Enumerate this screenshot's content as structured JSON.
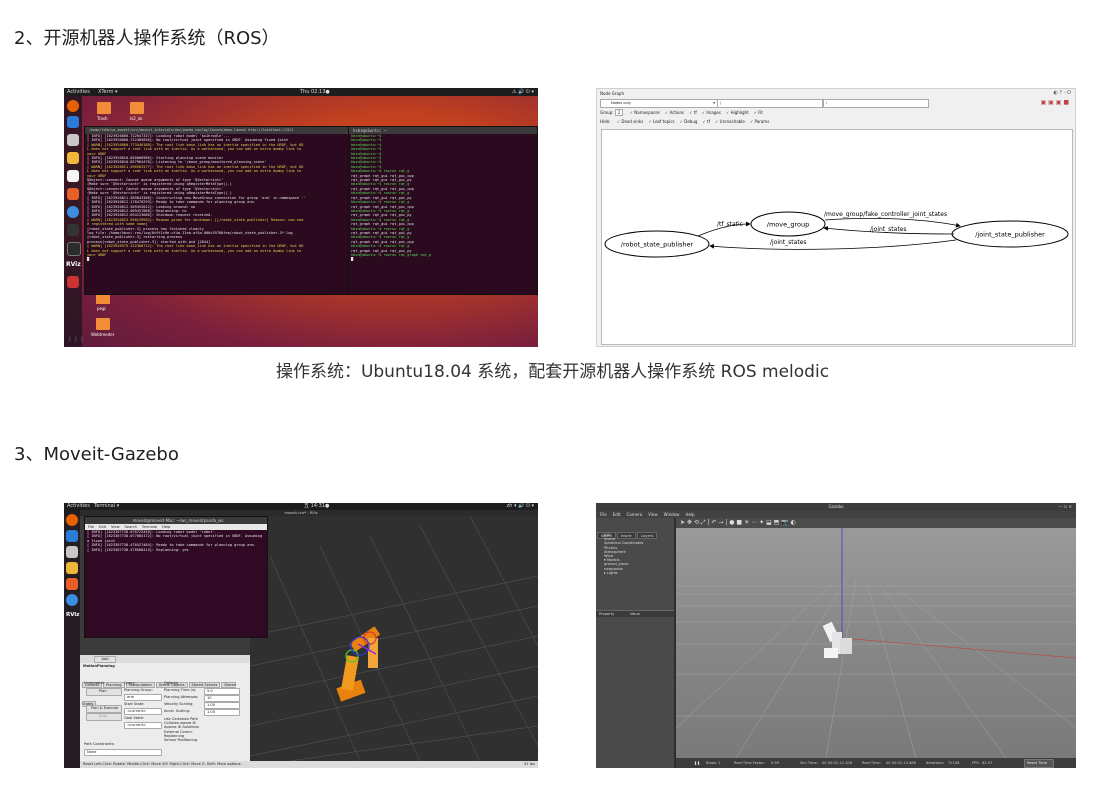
{
  "section2": {
    "title": "2、开源机器人操作系统（ROS）"
  },
  "caption2": "操作系统：Ubuntu18.04 系统，配套开源机器人操作系统 ROS melodic",
  "section3": {
    "title": "3、Moveit-Gazebo"
  },
  "ubuntu_desktop": {
    "topbar_left": "Activities",
    "topbar_app": "XTerm ▾",
    "topbar_clock": "Thu 02:13●",
    "desktop_icons": [
      "Trash",
      "ls2_ok",
      "pegi",
      "Webtreeder"
    ],
    "dock_label_rviz": "RViz",
    "left_terminal_title": "/home/lshb/ws_moveit/src/moveit_tutorials/doc/panda_config/launch/demo.launch http://localhost:11311",
    "right_terminal_title": "hsbz@ubuntu: ~",
    "left_terminal_lines": [
      "[ INFO] [1623926860.722047337]: Loading robot model 'ko1hrodle'...",
      "[ INFO] [1623926860.722485850]: No root/virtual joint specified in SRDF. Assuming fixed joint",
      "[ WARN] [1623926860.773440188]: The root link base_link has an inertia specified in the URDF, but KD",
      "L does not support a root link with an inertia. As a workaround, you can add an extra dummy link to",
      "your URDF",
      "[ INFO] [1623926810.850066986]: Starting planning scene monitor",
      "[ INFO] [1623926810.857964476]: Listening to '/move_group/monitored_planning_scene'",
      "[ WARN] [1623926811.490562577]: The root link base_link has an inertia specified in the URDF, but KD",
      "L does not support a root link with an inertia. As a workaround, you can add an extra dummy link to",
      "your URDF",
      "QObject::connect: Cannot queue arguments of type 'QVector<int>'",
      "(Make sure 'QVector<int>' is registered using qRegisterMetaType().)",
      "QObject::connect: Cannot queue arguments of type 'QVector<int>'",
      "(Make sure 'QVector<int>' is registered using qRegisterMetaType().)",
      "[ INFO] [1623926811.589843306]: Constructing new MoveGroup connection for group 'arm' in namespace ''",
      "",
      "[ INFO] [1623926812.178476293]: Ready to take commands for planning group arm.",
      "[ INFO] [1623926812.509453012]: Looking around: no",
      "[ INFO] [1623926812.509457866]: Replanning: no",
      "[ INFO] [1623926812.654123686]: Shutdown request received.",
      "[ WARN] [1623926823.958129932]: Reason given for shutdown: [[/robot_state_publisher] Reason: new nod",
      "e registered with same name]",
      "[robot_state_publisher-3] process has finished cleanly",
      "log file: /home/hbzn/.ros/log/8c9f1c9e-cf4a-11eb-af5a-000c29700fea/robot_state_publisher-3*.log",
      "[robot_state_publisher-3] restarting process",
      "process[robot_state_publisher-3]: started with pid [2844]",
      "[ WARN] [1623926975.122368712]: The root link base_link has an inertia specified in the URDF, but KD",
      "L does not support a root link with an inertia. As a workaround, you can add an extra dummy link to",
      "your URDF",
      "█"
    ],
    "right_terminal_lines": [
      "hbzn@ubuntu:~$",
      "hbzn@ubuntu:~$",
      "hbzn@ubuntu:~$",
      "hbzn@ubuntu:~$",
      "hbzn@ubuntu:~$",
      "hbzn@ubuntu:~$",
      "hbzn@ubuntu:~$",
      "hbzn@ubuntu:~$",
      "hbzn@ubuntu:~$ rosrun rqt_g",
      "rqt_graph    rqt_gui    rqt_gui_cpp",
      "rqt_graph    rqt_gui    rqt_gui_py",
      "hbzn@ubuntu:~$ rosrun rqt_g",
      "rqt_graph    rqt_gui    rqt_gui_cpp",
      "hbzn@ubuntu:~$ rosrun rqt_g",
      "rqt_graph    rqt_gui    rqt_gui_py",
      "hbzn@ubuntu:~$ rosrun rqt_g",
      "rqt_graph    rqt_gui    rqt_gui_cpp",
      "hbzn@ubuntu:~$ rosrun rqt_g",
      "rqt_graph    rqt_gui    rqt_gui_py",
      "hbzn@ubuntu:~$ rosrun rqt_g",
      "rqt_graph    rqt_gui    rqt_gui_cpp",
      "hbzn@ubuntu:~$ rosrun rqt_g",
      "rqt_graph    rqt_gui    rqt_gui_py",
      "hbzn@ubuntu:~$ rosrun rqt_g",
      "rqt_graph    rqt_gui    rqt_gui_cpp",
      "hbzn@ubuntu:~$ rosrun rqt_g",
      "rqt_graph    rqt_gui    rqt_gui_py",
      "hbzn@ubuntu:~$ rosrun rqt_graph rqt_g",
      "█"
    ]
  },
  "node_graph": {
    "window_title": "Node Graph",
    "filter_select": "Nodes only",
    "filter_text1": "/",
    "filter_text2": "/",
    "group_label": "Group:",
    "group_value": "2",
    "checks_row1": [
      "Namespaces",
      "Actions",
      "tf",
      "Images",
      "Highlight",
      "Fit"
    ],
    "hide_label": "Hide:",
    "checks_row2": [
      "Dead sinks",
      "Leaf topics",
      "Debug",
      "tf",
      "Unreachable",
      "Params"
    ],
    "nodes": {
      "move_group": "/move_group",
      "joint_state_publisher": "/joint_state_publisher",
      "robot_state_publisher": "/robot_state_publisher"
    },
    "edges": {
      "tf_static": "/tf_static",
      "fake_controller": "/move_group/fake_controller_joint_states",
      "joint_states_1": "/joint_states",
      "joint_states_2": "/joint_states"
    }
  },
  "moveit": {
    "topbar_left": "Activities",
    "topbar_app": "Terminal ▾",
    "topbar_clock": "五 14:31●",
    "terminal_title": "moveit@moveit-Mac: ~/ws_moveit/panda_ws",
    "terminal_menu": [
      "File",
      "Edit",
      "View",
      "Search",
      "Terminal",
      "Help"
    ],
    "terminal_lines": [
      "[ INFO] [1623307738.076723450]: Loading robot model 'robot'...",
      "[ INFO] [1623307738.077085172]: No root/virtual joint specified in SRDF. Assuming",
      "a fixed joint",
      "[ INFO] [1623307738.478427464]: Ready to take commands for planning group arm.",
      "[ INFO] [1623307738.478568415]: Replanning: yes"
    ],
    "rviz_title": "moveit.rviz* - RViz",
    "dock_label": "RViz",
    "panel_title": "MotionPlanning",
    "tabs": [
      "Context",
      "Planning",
      "Manipulation",
      "Scene Objects",
      "Stored Scenes",
      "Stored States"
    ],
    "col_commands": "Commands",
    "col_query": "Query",
    "col_options": "Options",
    "btn_plan": "Plan",
    "btn_plan_execute": "Plan & Execute",
    "btn_stop": "Stop",
    "planning_group_label": "Planning Group:",
    "planning_group_value": "arm",
    "start_state_label": "Start State:",
    "start_state_value": "<current>",
    "goal_state_label": "Goal State:",
    "goal_state_value": "<current>",
    "planning_time_label": "Planning Time (s):",
    "planning_time_value": "5.0",
    "planning_attempts_label": "Planning Attempts:",
    "planning_attempts_value": "10",
    "velocity_label": "Velocity Scaling:",
    "velocity_value": "1.00",
    "accel_label": "Accel. Scaling:",
    "accel_value": "1.00",
    "checks": [
      "Use Cartesian Path",
      "Collision-aware IK",
      "Approx IK Solutions",
      "External Comm.",
      "Replanning",
      "Sensor Positioning"
    ],
    "path_constraints_label": "Path Constraints:",
    "path_constraints_value": "None",
    "toolbar_add": "Add",
    "status_bar": "Reset   Left-Click: Rotate. Middle-Click: Move X/Y. Right-Click: Move Z. Shift: More options.",
    "fps": "31 fps"
  },
  "gazebo": {
    "title": "Gazebo",
    "menu": [
      "File",
      "Edit",
      "Camera",
      "View",
      "Window",
      "Help"
    ],
    "tabs": [
      "World",
      "Insert",
      "Layers"
    ],
    "tree": [
      "GUI",
      "Scene",
      "Spherical Coordinates",
      "Physics",
      "Atmosphere",
      "Wind",
      "▾ Models",
      "ground_plane",
      "newpanda",
      "▸ Lights"
    ],
    "property_col": "Property",
    "value_col": "Value",
    "status_steps_label": "Steps:",
    "status_steps_value": "1",
    "status_rtf_label": "Real Time Factor:",
    "status_rtf_value": "0.99",
    "status_sim_label": "Sim Time:",
    "status_sim_value": "00 00:01:12.108",
    "status_real_label": "Real Time:",
    "status_real_value": "00 00:01:13.468",
    "status_iter_label": "Iterations:",
    "status_iter_value": "72108",
    "status_fps_label": "FPS:",
    "status_fps_value": "62.57",
    "reset_time": "Reset Time"
  },
  "colors": {
    "ubuntu_orange": "#e95420",
    "terminal_bg": "#2b0a1f",
    "terminal_green": "#58e052",
    "terminal_yellow": "#e6d84a",
    "gazebo_sky": "#8e8e8e"
  }
}
